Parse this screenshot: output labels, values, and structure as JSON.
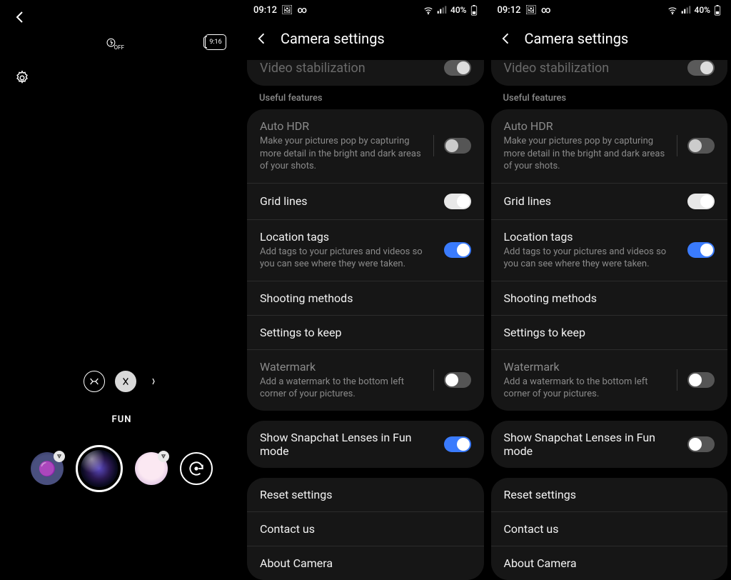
{
  "camera": {
    "ratio_label": "9:16",
    "flash_label": "OFF",
    "mode": "FUN"
  },
  "status": {
    "time": "09:12",
    "battery_pct": "40%"
  },
  "settings": {
    "title": "Camera settings",
    "peek_row": "Video stabilization",
    "section_useful": "Useful features",
    "auto_hdr": {
      "title": "Auto HDR",
      "sub": "Make your pictures pop by capturing more detail in the bright and dark areas of your shots."
    },
    "grid": {
      "title": "Grid lines"
    },
    "location": {
      "title": "Location tags",
      "sub": "Add tags to your pictures and videos so you can see where they were taken."
    },
    "shooting": {
      "title": "Shooting methods"
    },
    "keep": {
      "title": "Settings to keep"
    },
    "watermark": {
      "title": "Watermark",
      "sub": "Add a watermark to the bottom left corner of your pictures."
    },
    "snapchat": {
      "title": "Show Snapchat Lenses in Fun mode"
    },
    "reset": "Reset settings",
    "contact": "Contact us",
    "about": "About Camera"
  },
  "toggles_a": {
    "snapchat_on": true
  },
  "toggles_b": {
    "snapchat_on": false
  }
}
